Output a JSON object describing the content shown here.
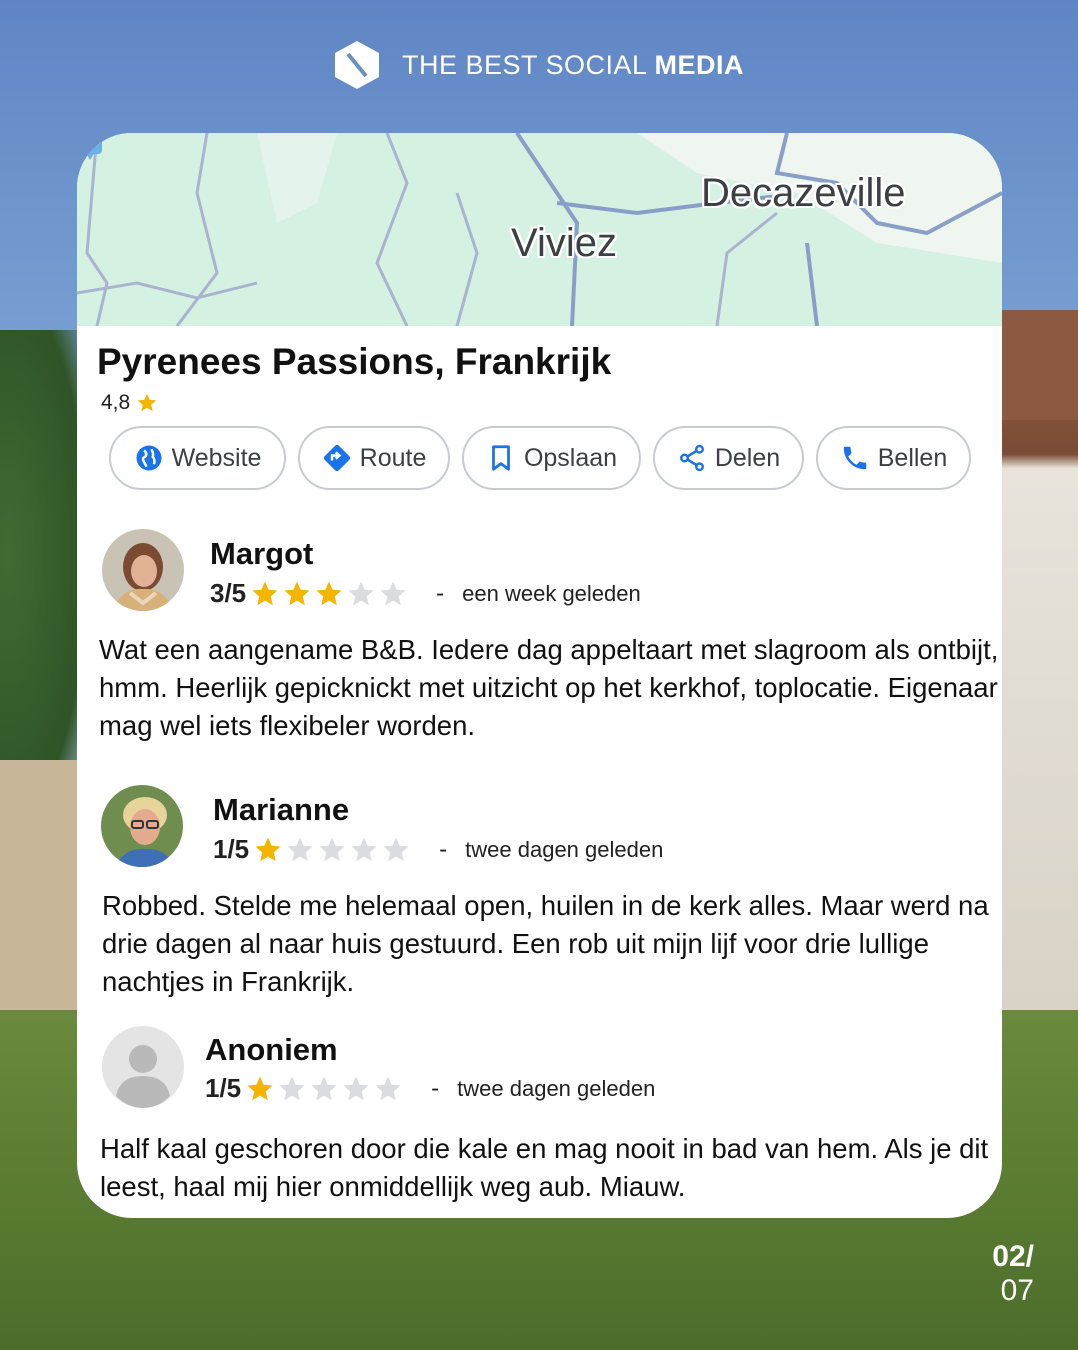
{
  "brand": {
    "name_regular": "THE BEST SOCIAL ",
    "name_bold": "MEDIA"
  },
  "map": {
    "labels": [
      "Decazeville",
      "Viviez"
    ]
  },
  "place": {
    "title": "Pyrenees Passions, Frankrijk",
    "rating": "4,8"
  },
  "actions": [
    {
      "label": "Website",
      "icon": "globe-icon"
    },
    {
      "label": "Route",
      "icon": "directions-icon"
    },
    {
      "label": "Opslaan",
      "icon": "bookmark-icon"
    },
    {
      "label": "Delen",
      "icon": "share-icon"
    },
    {
      "label": "Bellen",
      "icon": "phone-icon"
    }
  ],
  "reviews": [
    {
      "name": "Margot",
      "score": "3/5",
      "stars": 3,
      "dash": "-",
      "time": "een week geleden",
      "text": "Wat een aangename B&B. Iedere dag appeltaart met slagroom als ontbijt, hmm. Heerlijk gepicknickt met uitzicht op het kerkhof, toplocatie. Eigenaar mag wel iets flexibeler worden."
    },
    {
      "name": "Marianne",
      "score": "1/5",
      "stars": 1,
      "dash": "-",
      "time": "twee dagen geleden",
      "text": "Robbed. Stelde me helemaal open, huilen in de kerk alles. Maar werd na drie dagen al naar huis gestuurd. Een rob uit mijn lijf voor drie lullige nachtjes in Frankrijk."
    },
    {
      "name": "Anoniem",
      "score": "1/5",
      "stars": 1,
      "dash": "-",
      "time": "twee dagen geleden",
      "text": "Half kaal geschoren door die kale en mag nooit in bad van hem. Als je dit leest, haal mij hier onmiddellijk weg aub. Miauw."
    }
  ],
  "pagination": {
    "current": "02/",
    "total": "07"
  },
  "colors": {
    "star_filled": "#f5b400",
    "star_empty": "#dadce0",
    "accent_blue": "#1a73e8",
    "map_green": "#d4f1e1"
  }
}
